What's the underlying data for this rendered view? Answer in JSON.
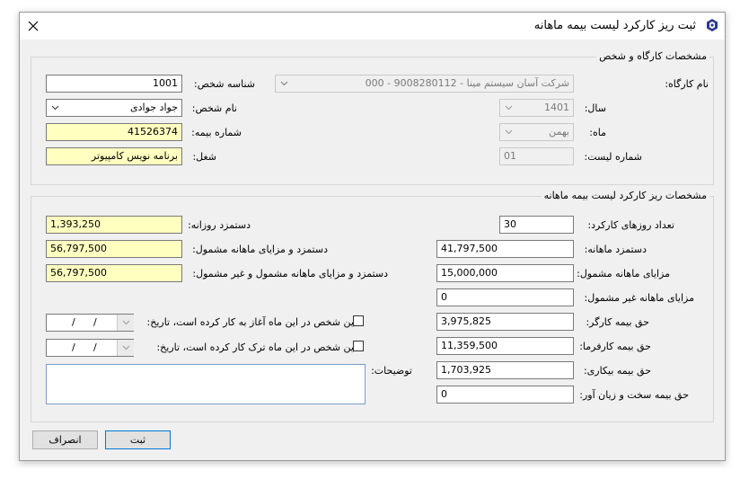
{
  "window": {
    "title": "ثبت ریز کارکرد لیست بیمه ماهانه",
    "close_glyph": "✕"
  },
  "workshop_group": {
    "legend": "مشخصات کارگاه و شخص",
    "workshop_name_label": "نام کارگاه:",
    "workshop_name_value": "شرکت آسان سیستم مینا - 9008280112 - 000",
    "year_label": "سال:",
    "year_value": "1401",
    "month_label": "ماه:",
    "month_value": "بهمن",
    "list_number_label": "شماره لیست:",
    "list_number_value": "01",
    "person_id_label": "شناسه شخص:",
    "person_id_value": "1001",
    "person_name_label": "نام شخص:",
    "person_name_value": "جواد جوادی",
    "insurance_number_label": "شماره بیمه:",
    "insurance_number_value": "41526374",
    "job_label": "شغل:",
    "job_value": "برنامه نویس کامپیوتر"
  },
  "details_group": {
    "legend": "مشخصات ریز کارکرد لیست بیمه ماهانه",
    "work_days_label": "تعداد روزهای کارکرد:",
    "work_days_value": "30",
    "monthly_wage_label": "دستمزد ماهانه:",
    "monthly_wage_value": "41,797,500",
    "covered_benefits_label": "مزایای ماهانه مشمول:",
    "covered_benefits_value": "15,000,000",
    "noncovered_benefits_label": "مزایای ماهانه غیر مشمول:",
    "noncovered_benefits_value": "0",
    "worker_share_label": "حق بیمه کارگر:",
    "worker_share_value": "3,975,825",
    "employer_share_label": "حق بیمه کارفرما:",
    "employer_share_value": "11,359,500",
    "unemployment_label": "حق بیمه بیکاری:",
    "unemployment_value": "1,703,925",
    "hard_jobs_label": "حق بیمه سخت و زیان آور:",
    "hard_jobs_value": "0",
    "daily_wage_label": "دستمزد روزانه:",
    "daily_wage_value": "1,393,250",
    "wage_covered_label": "دستمزد و مزایای ماهانه مشمول:",
    "wage_covered_value": "56,797,500",
    "wage_all_label": "دستمزد و مزایای ماهانه مشمول و غیر مشمول:",
    "wage_all_value": "56,797,500",
    "start_check_label": "این شخص در این ماه آغاز به کار کرده است، تاریخ:",
    "end_check_label": "این شخص در این ماه ترک کار کرده است،   تاریخ:",
    "date_separator": "/",
    "notes_label": "توضیحات:",
    "notes_value": ""
  },
  "buttons": {
    "submit_label": "ثبت",
    "cancel_label": "انصراف"
  },
  "colors": {
    "required_field": "#ffffc0",
    "window_bg": "#f0f0f0",
    "primary_border": "#0078d7"
  }
}
